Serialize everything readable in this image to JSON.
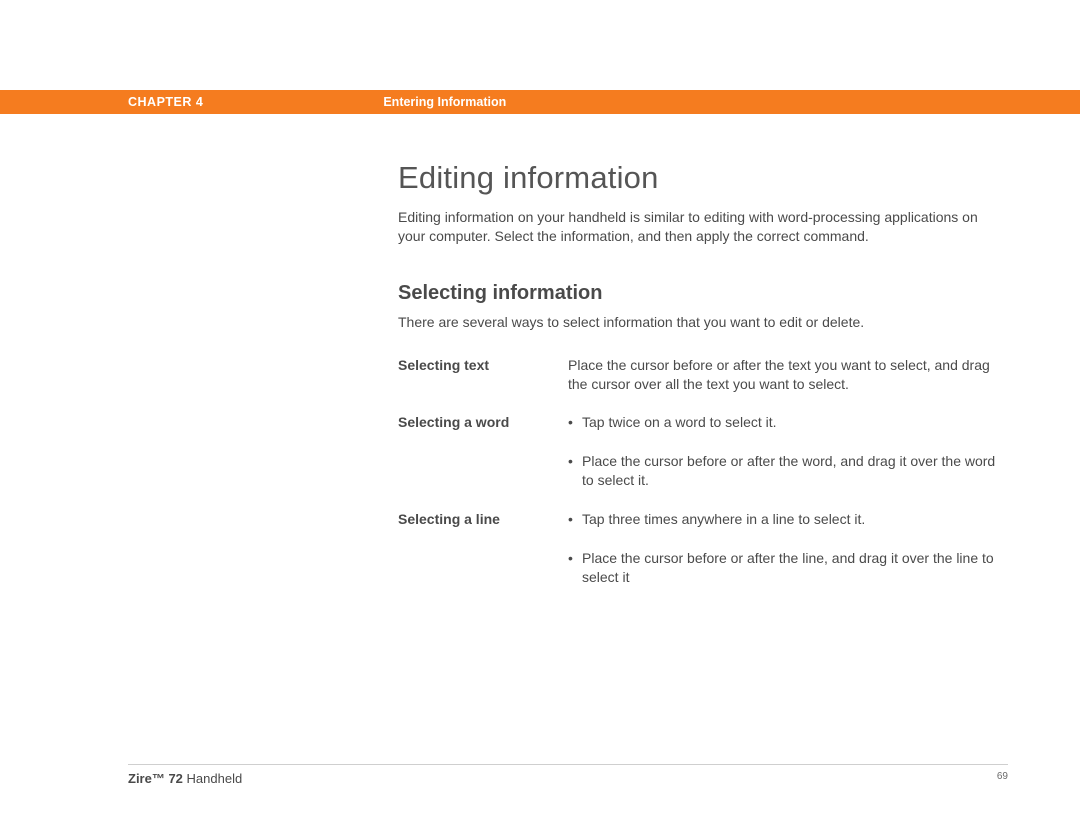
{
  "header": {
    "chapter": "CHAPTER 4",
    "section": "Entering Information"
  },
  "main": {
    "heading": "Editing information",
    "intro": "Editing information on your handheld is similar to editing with word-processing applications on your computer. Select the information, and then apply the correct command.",
    "subheading": "Selecting information",
    "subintro": "There are several ways to select information that you want to edit or delete.",
    "definitions": [
      {
        "term": "Selecting text",
        "plain": "Place the cursor before or after the text you want to select, and drag the cursor over all the text you want to select."
      },
      {
        "term": "Selecting a word",
        "bullets": [
          "Tap twice on a word to select it.",
          "Place the cursor before or after the word, and drag it over the word to select it."
        ]
      },
      {
        "term": "Selecting a line",
        "bullets": [
          "Tap three times anywhere in a line to select it.",
          "Place the cursor before or after the line, and drag it over the line to select it"
        ]
      }
    ]
  },
  "footer": {
    "product_bold": "Zire™ 72",
    "product_rest": " Handheld",
    "page": "69"
  }
}
